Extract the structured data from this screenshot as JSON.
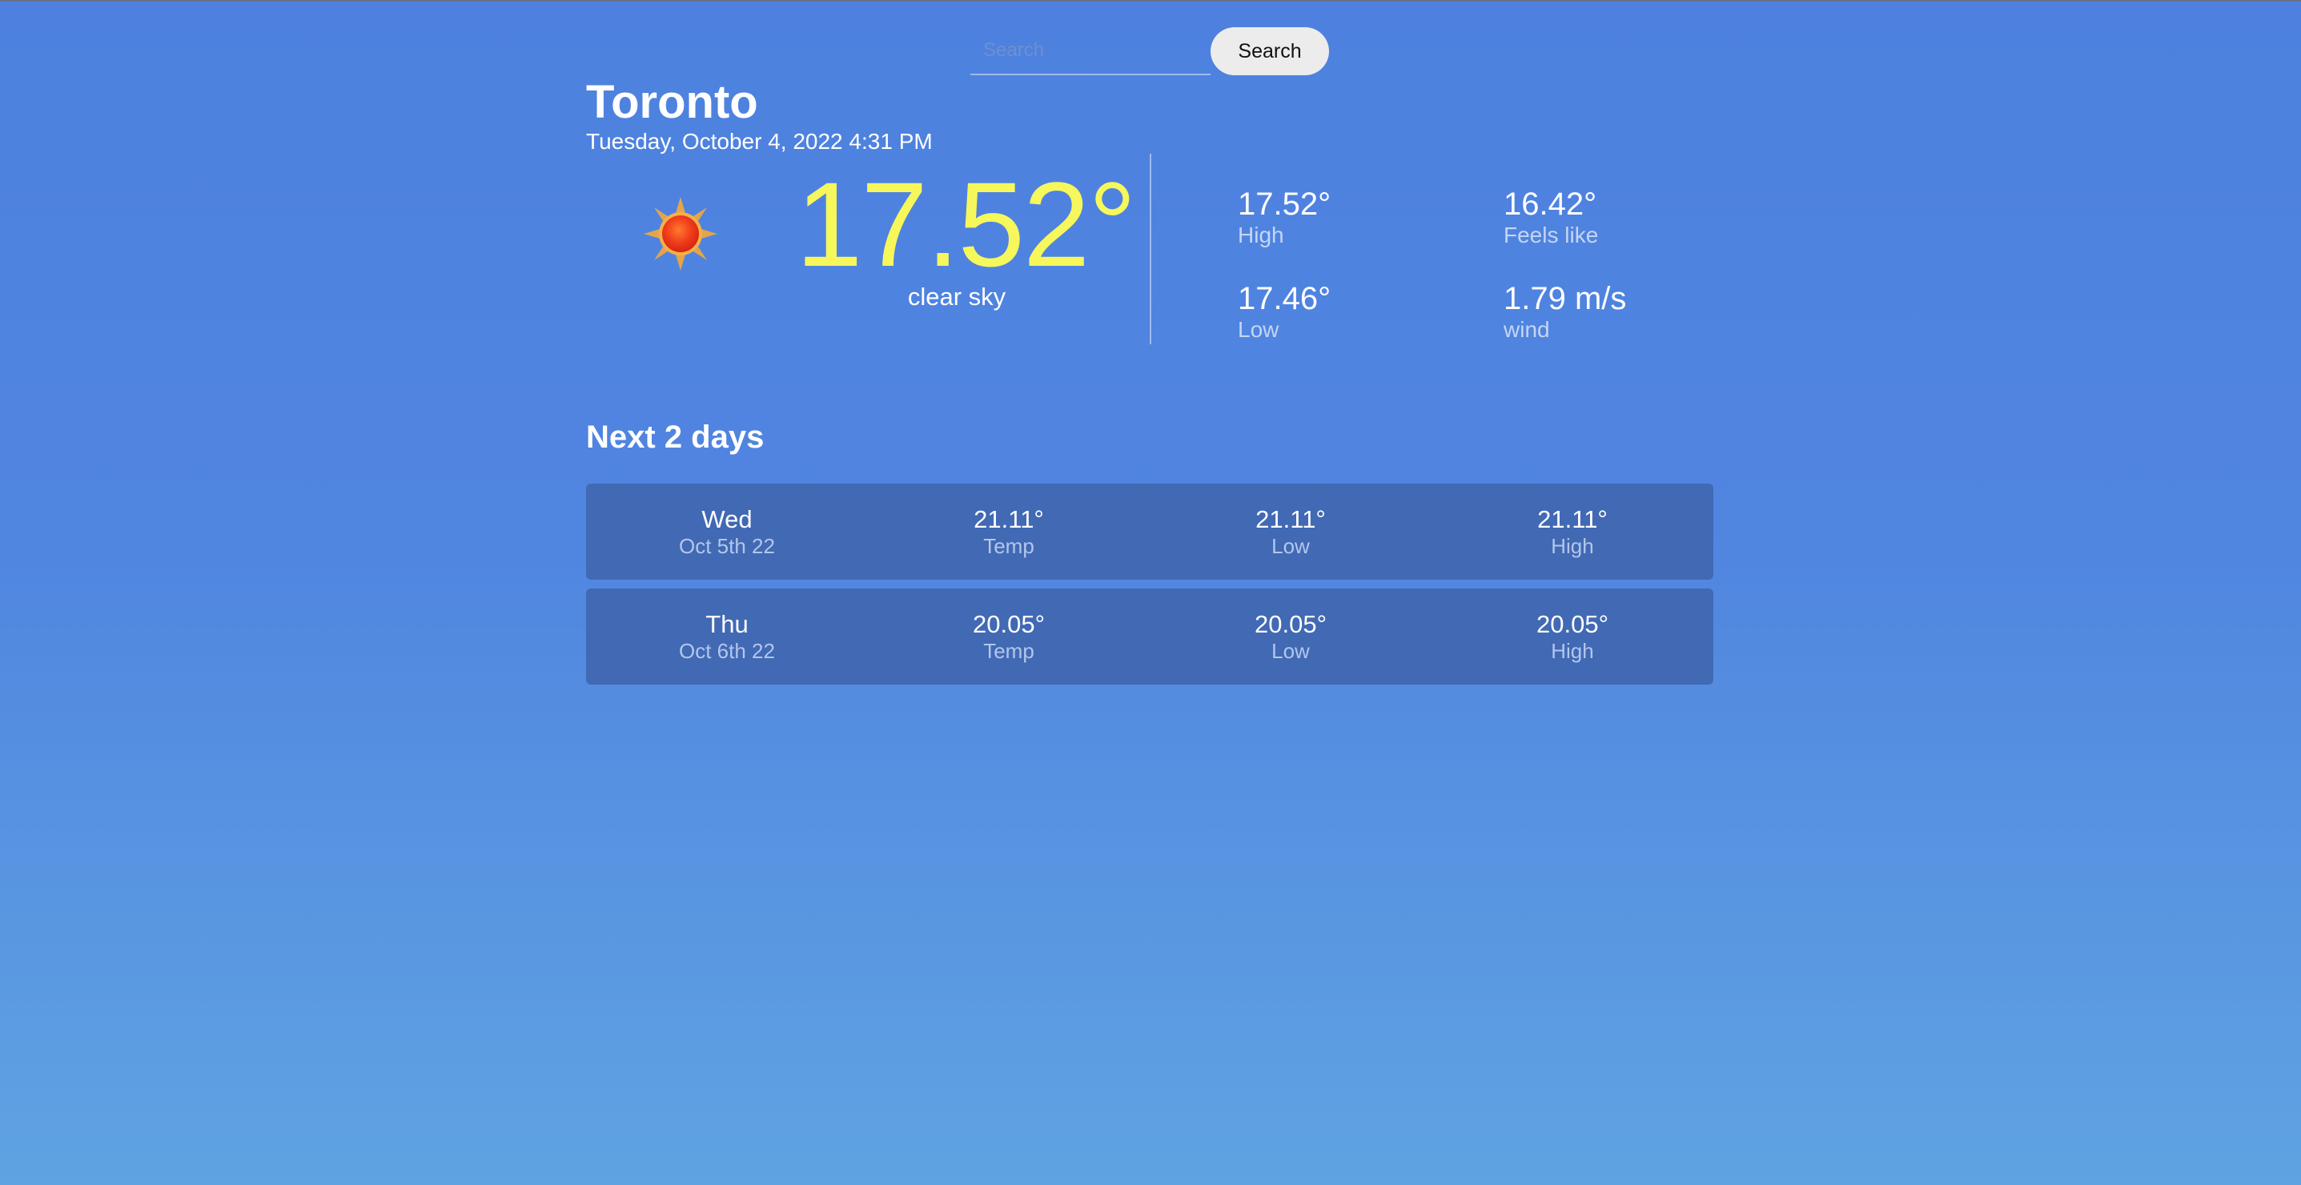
{
  "search": {
    "placeholder": "Search",
    "button_label": "Search"
  },
  "current": {
    "city": "Toronto",
    "datetime": "Tuesday, October 4, 2022 4:31 PM",
    "icon": "sun-icon",
    "temperature": "17.52°",
    "condition": "clear sky",
    "stats": {
      "high": {
        "value": "17.52°",
        "label": "High"
      },
      "feels_like": {
        "value": "16.42°",
        "label": "Feels like"
      },
      "low": {
        "value": "17.46°",
        "label": "Low"
      },
      "wind": {
        "value": "1.79 m/s",
        "label": "wind"
      }
    }
  },
  "forecast": {
    "title": "Next 2 days",
    "days": [
      {
        "day": "Wed",
        "date": "Oct 5th 22",
        "temp": "21.11°",
        "temp_label": "Temp",
        "low": "21.11°",
        "low_label": "Low",
        "high": "21.11°",
        "high_label": "High"
      },
      {
        "day": "Thu",
        "date": "Oct 6th 22",
        "temp": "20.05°",
        "temp_label": "Temp",
        "low": "20.05°",
        "low_label": "Low",
        "high": "20.05°",
        "high_label": "High"
      }
    ]
  },
  "colors": {
    "background_top": "#4e81df",
    "background_bottom": "#5fa3e2",
    "temperature": "#f6f75a",
    "forecast_row": "#4169b4"
  }
}
